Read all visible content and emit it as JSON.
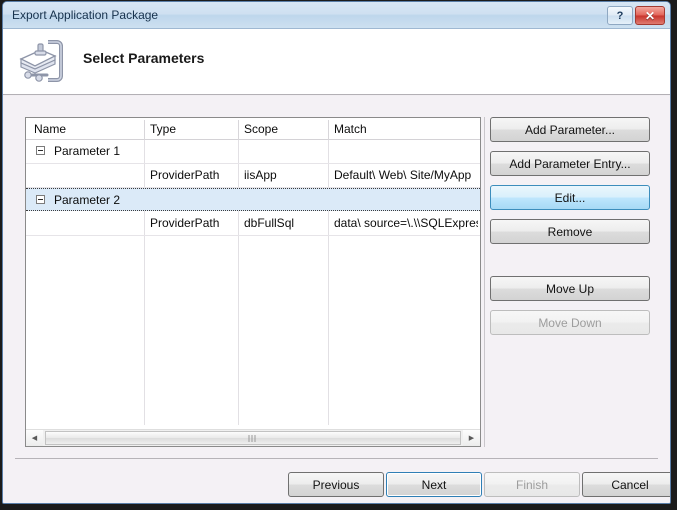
{
  "window": {
    "title": "Export Application Package",
    "help_label": "?",
    "close_label": "✕"
  },
  "header": {
    "title": "Select Parameters",
    "icon": "package-clamp-icon"
  },
  "grid": {
    "columns": [
      "Name",
      "Type",
      "Scope",
      "Match"
    ],
    "rows": [
      {
        "type": "group",
        "name": "Parameter 1",
        "col_type": "",
        "scope": "",
        "match": "",
        "expanded": true,
        "selected": false
      },
      {
        "type": "entry",
        "name": "",
        "col_type": "ProviderPath",
        "scope": "iisApp",
        "match": "Default\\ Web\\ Site/MyApp",
        "selected": false
      },
      {
        "type": "group",
        "name": "Parameter 2",
        "col_type": "",
        "scope": "",
        "match": "",
        "expanded": true,
        "selected": true
      },
      {
        "type": "entry",
        "name": "",
        "col_type": "ProviderPath",
        "scope": "dbFullSql",
        "match": "data\\ source=\\.\\\\SQLExpress",
        "selected": false
      }
    ],
    "scrollbar": {
      "left_arrow": "◀",
      "right_arrow": "▶",
      "grip": "scrollbar-grip"
    }
  },
  "side_buttons": [
    {
      "label": "Add Parameter...",
      "state": "normal"
    },
    {
      "label": "Add Parameter Entry...",
      "state": "normal"
    },
    {
      "label": "Edit...",
      "state": "hover"
    },
    {
      "label": "Remove",
      "state": "normal"
    },
    {
      "label": "Move Up",
      "state": "normal"
    },
    {
      "label": "Move Down",
      "state": "disabled"
    }
  ],
  "footer_buttons": [
    {
      "label": "Previous",
      "state": "normal"
    },
    {
      "label": "Next",
      "state": "focus"
    },
    {
      "label": "Finish",
      "state": "disabled"
    },
    {
      "label": "Cancel",
      "state": "normal"
    }
  ],
  "colors": {
    "titlebar": "#cfe0f1",
    "selection": "#dbeaf8",
    "hover_accent": "#bee6fd",
    "close_red": "#c8342c",
    "body": "#f4f1f5"
  }
}
